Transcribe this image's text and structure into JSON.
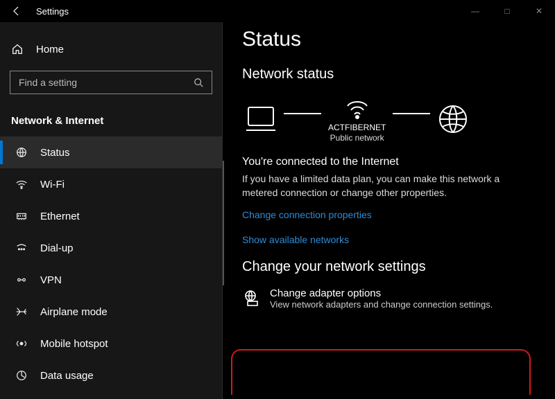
{
  "window": {
    "title": "Settings",
    "min": "—",
    "max": "□",
    "close": "✕"
  },
  "sidebar": {
    "home": "Home",
    "search_placeholder": "Find a setting",
    "section": "Network & Internet",
    "items": [
      {
        "label": "Status",
        "icon": "status-icon",
        "active": true
      },
      {
        "label": "Wi-Fi",
        "icon": "wifi-icon",
        "active": false
      },
      {
        "label": "Ethernet",
        "icon": "ethernet-icon",
        "active": false
      },
      {
        "label": "Dial-up",
        "icon": "dialup-icon",
        "active": false
      },
      {
        "label": "VPN",
        "icon": "vpn-icon",
        "active": false
      },
      {
        "label": "Airplane mode",
        "icon": "airplane-icon",
        "active": false
      },
      {
        "label": "Mobile hotspot",
        "icon": "hotspot-icon",
        "active": false
      },
      {
        "label": "Data usage",
        "icon": "data-icon",
        "active": false
      }
    ]
  },
  "main": {
    "title": "Status",
    "network_status_heading": "Network status",
    "router_name": "ACTFIBERNET",
    "router_sub": "Public network",
    "connected_heading": "You're connected to the Internet",
    "connected_desc": "If you have a limited data plan, you can make this network a metered connection or change other properties.",
    "link_change_props": "Change connection properties",
    "link_show_networks": "Show available networks",
    "settings_heading": "Change your network settings",
    "adapter_title": "Change adapter options",
    "adapter_desc": "View network adapters and change connection settings."
  }
}
